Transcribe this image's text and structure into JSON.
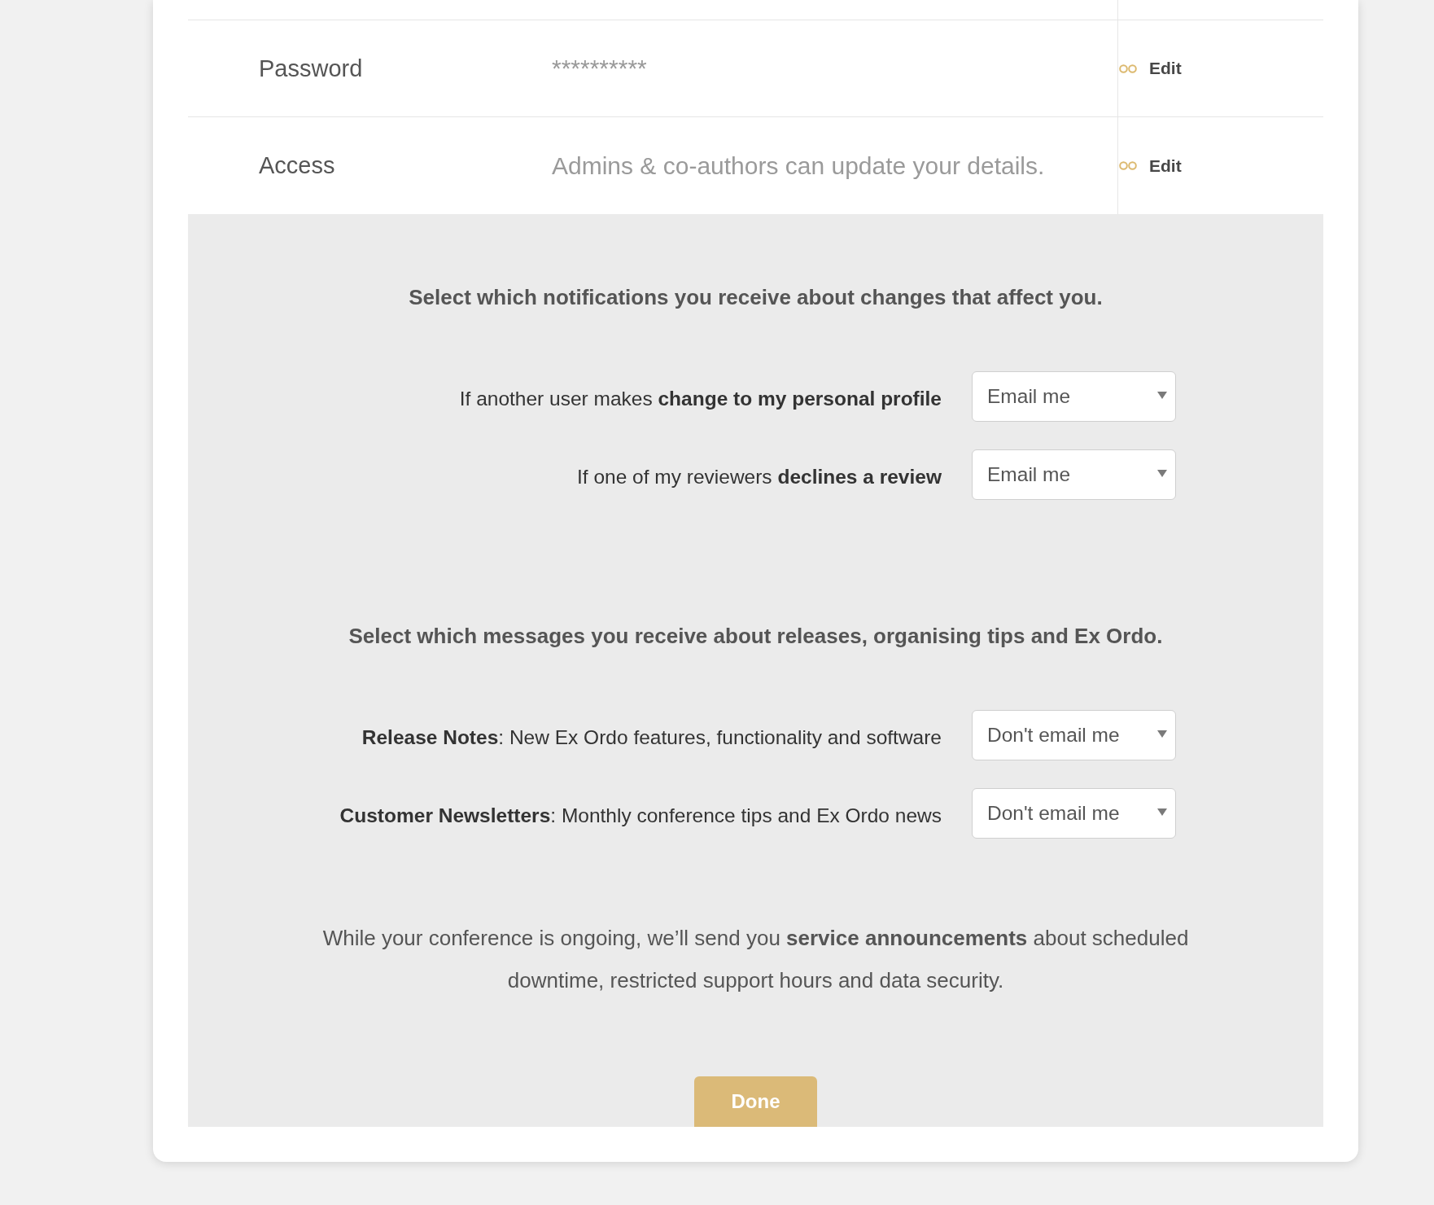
{
  "account_rows": [
    {
      "label": "Password",
      "value": "**********",
      "action": "Edit"
    },
    {
      "label": "Access",
      "value": "Admins & co-authors can update your details.",
      "action": "Edit"
    }
  ],
  "notifications": {
    "heading": "Select which notifications you receive about changes that affect you.",
    "settings": [
      {
        "text": "If another user makes **change to my personal profile**",
        "value": "Email me"
      },
      {
        "text": "If one of my reviewers **declines a review**",
        "value": "Email me"
      }
    ]
  },
  "messages": {
    "heading": "Select which messages you receive about releases, organising tips and Ex Ordo.",
    "settings": [
      {
        "text": "**Release Notes**: New Ex Ordo features, functionality and software",
        "value": "Don't email me"
      },
      {
        "text": "**Customer Newsletters**: Monthly conference tips and Ex Ordo news",
        "value": "Don't email me"
      }
    ]
  },
  "service_note": "While your conference is ongoing, we’ll send you **service announcements** about scheduled downtime, restricted support hours and data security.",
  "done_button": {
    "label": "Done"
  }
}
